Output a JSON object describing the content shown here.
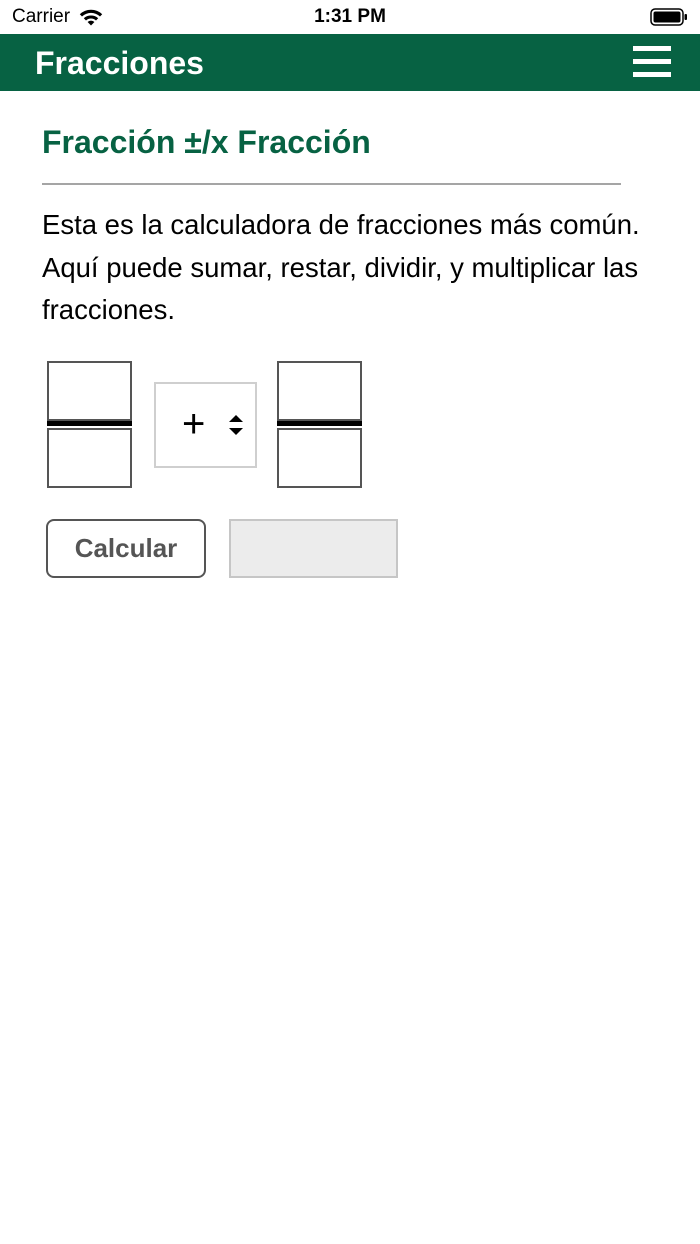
{
  "status_bar": {
    "carrier": "Carrier",
    "time": "1:31 PM"
  },
  "header": {
    "title": "Fracciones",
    "menu_icon": "hamburger-menu-icon",
    "background_color": "#076243"
  },
  "main": {
    "section_title": "Fracción ±/x Fracción",
    "description": "Esta es la calculadora de fracciones más común. Aquí puede sumar, restar, dividir, y multiplicar las fracciones.",
    "fraction_1": {
      "numerator": "",
      "denominator": ""
    },
    "operator": {
      "selected": "+"
    },
    "fraction_2": {
      "numerator": "",
      "denominator": ""
    },
    "calculate_label": "Calcular",
    "result": ""
  },
  "colors": {
    "accent": "#076243",
    "result_background": "#ececec"
  }
}
